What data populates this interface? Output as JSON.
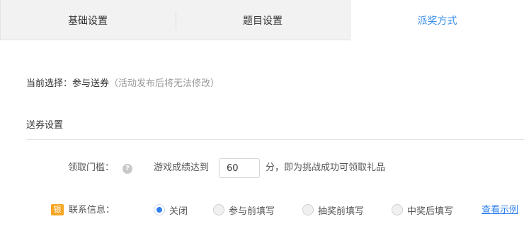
{
  "tabs": [
    {
      "label": "基础设置",
      "active": false
    },
    {
      "label": "题目设置",
      "active": false
    },
    {
      "label": "派奖方式",
      "active": true
    }
  ],
  "colors": {
    "accent": "#3a8ee6",
    "link": "#2f80ed",
    "badge": "#f5a623",
    "muted_text": "#999999"
  },
  "current_selection": {
    "label": "当前选择：",
    "value": "参与送券",
    "note": "（活动发布后将无法修改）"
  },
  "section": {
    "title": "送券设置"
  },
  "threshold": {
    "label": "领取门槛：",
    "help_icon": "question-circle-icon",
    "help_glyph": "?",
    "pre_text": "游戏成绩达到",
    "score_value": "60",
    "post_text": "分，即为挑战成功可领取礼品"
  },
  "contact": {
    "badge_text": "银",
    "label": "联系信息：",
    "options": [
      {
        "label": "关闭",
        "checked": true
      },
      {
        "label": "参与前填写",
        "checked": false
      },
      {
        "label": "抽奖前填写",
        "checked": false
      },
      {
        "label": "中奖后填写",
        "checked": false
      }
    ],
    "example_link": "查看示例"
  }
}
